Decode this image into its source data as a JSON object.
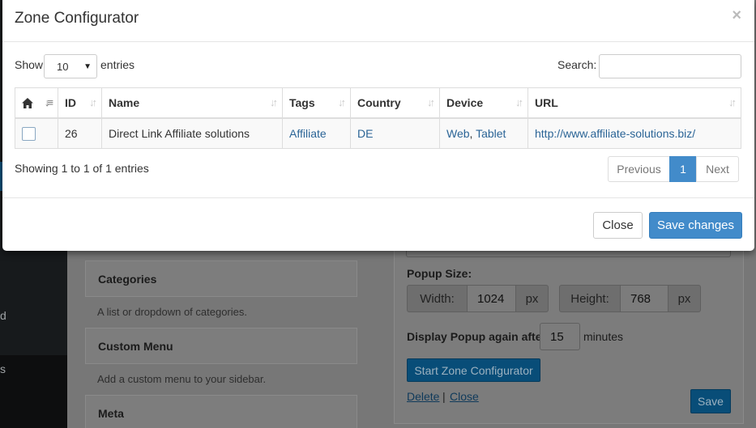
{
  "background": {
    "sidebar_items": [
      "d",
      "s"
    ],
    "widgets": [
      {
        "title": "Categories",
        "description": "A list or dropdown of categories."
      },
      {
        "title": "Custom Menu",
        "description": "Add a custom menu to your sidebar."
      },
      {
        "title": "Meta",
        "description": ""
      }
    ],
    "popup_size_label": "Popup Size:",
    "width_label": "Width:",
    "width_value": "1024",
    "width_unit": "px",
    "height_label": "Height:",
    "height_value": "768",
    "height_unit": "px",
    "display_again_label": "Display Popup again after",
    "display_again_value": "15",
    "display_again_unit": "minutes",
    "start_configurator_label": "Start Zone Configurator",
    "delete_link": "Delete",
    "separator": "|",
    "close_link": "Close",
    "save_label": "Save"
  },
  "modal": {
    "title": "Zone Configurator",
    "close_glyph": "×",
    "show_label": "Show",
    "entries_label": "entries",
    "page_length": "10",
    "search_label": "Search:",
    "search_value": "",
    "columns": [
      "",
      "ID",
      "Name",
      "Tags",
      "Country",
      "Device",
      "URL"
    ],
    "rows": [
      {
        "id": "26",
        "name": "Direct Link Affiliate solutions",
        "tags": "Affiliate",
        "country": "DE",
        "device_1": "Web",
        "device_sep": ",",
        "device_2": "Tablet",
        "url": "http://www.affiliate-solutions.biz/"
      }
    ],
    "info": "Showing 1 to 1 of 1 entries",
    "pagination": {
      "previous": "Previous",
      "current": "1",
      "next": "Next"
    },
    "footer": {
      "close_label": "Close",
      "save_label": "Save changes"
    }
  },
  "colors": {
    "primary": "#428bca",
    "link": "#2a6496",
    "sidebar": "#171a1c"
  }
}
